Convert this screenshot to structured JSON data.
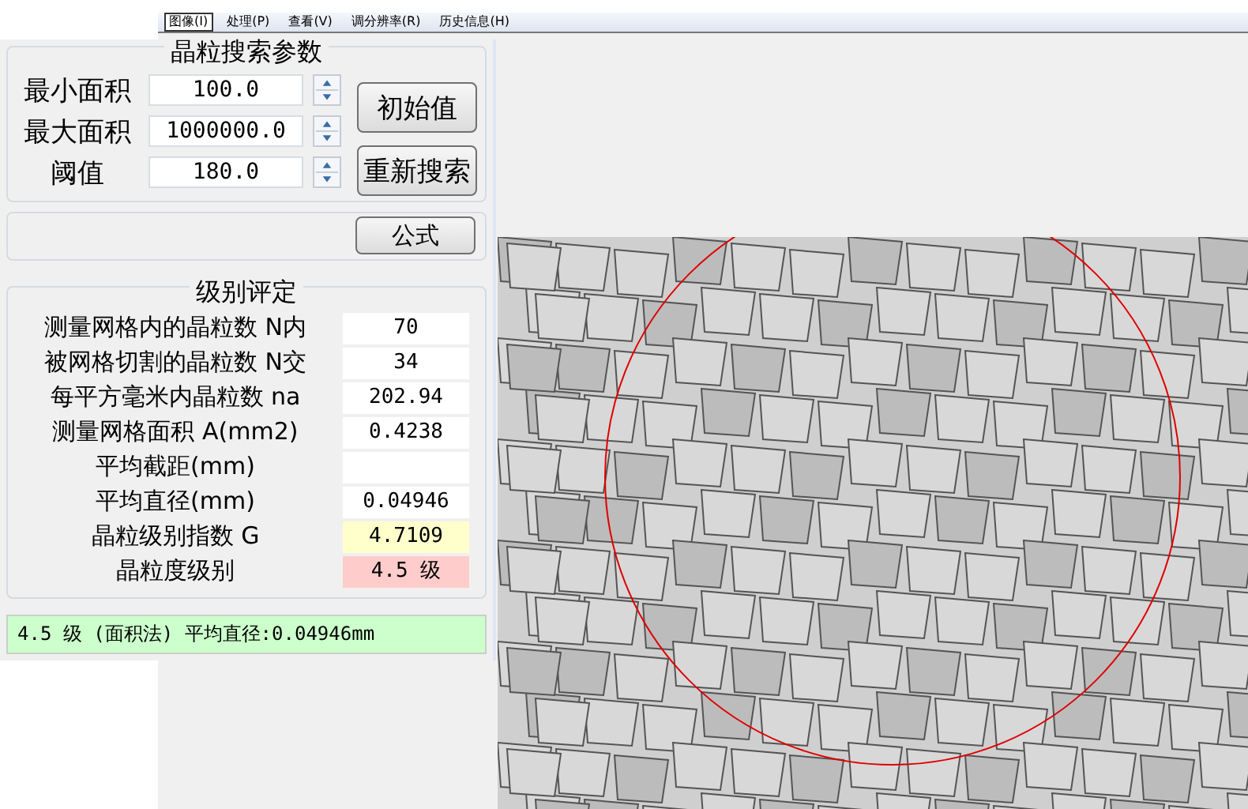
{
  "menu": [
    {
      "label": "图像(I)",
      "selected": true
    },
    {
      "label": "处理(P)",
      "selected": false
    },
    {
      "label": "查看(V)",
      "selected": false
    },
    {
      "label": "调分辨率(R)",
      "selected": false
    },
    {
      "label": "历史信息(H)",
      "selected": false
    }
  ],
  "search_params": {
    "title": "晶粒搜索参数",
    "fields": [
      {
        "label": "最小面积",
        "value": "100.0"
      },
      {
        "label": "最大面积",
        "value": "1000000.0"
      },
      {
        "label": "阈值",
        "value": "180.0"
      }
    ],
    "buttons": [
      "初始值",
      "重新搜索"
    ]
  },
  "formula_button": "公式",
  "grading": {
    "title": "级别评定",
    "rows": [
      {
        "label": "测量网格内的晶粒数 N内",
        "value": "70"
      },
      {
        "label": "被网格切割的晶粒数 N交",
        "value": "34"
      },
      {
        "label": "每平方毫米内晶粒数 na",
        "value": "202.94"
      },
      {
        "label": "测量网格面积 A(mm2)",
        "value": "0.4238"
      },
      {
        "label": "平均截距(mm)"
      },
      {
        "label": "平均直径(mm)",
        "value": "0.04946"
      },
      {
        "label": "晶粒级别指数 G",
        "value": "4.7109",
        "color": "#ffffcc"
      },
      {
        "label": "晶粒度级别",
        "value": "4.5 级",
        "color": "#ffcccc"
      }
    ]
  },
  "result": "4.5 级 (面积法) 平均直径:0.04946mm"
}
